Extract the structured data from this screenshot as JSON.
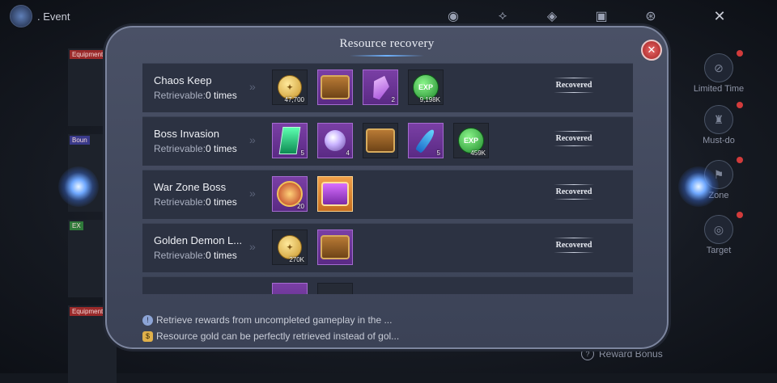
{
  "topbar": {
    "event_label": ". Event",
    "icons": [
      "portrait-icon",
      "emblem-icon",
      "crest-icon",
      "card-icon",
      "rune-icon"
    ],
    "close_glyph": "✕"
  },
  "background_tags": [
    "Equipment",
    "Boun",
    "EX",
    "Equipment"
  ],
  "sidebar_right": [
    {
      "label": "Limited Time",
      "icon": "prohibited-icon",
      "dot": true
    },
    {
      "label": "Must-do",
      "icon": "helmet-icon",
      "dot": true
    },
    {
      "label": "Zone",
      "icon": "flag-icon",
      "dot": true
    },
    {
      "label": "Target",
      "icon": "target-icon",
      "dot": true
    }
  ],
  "reward_bonus_label": "Reward Bonus",
  "modal": {
    "title": "Resource recovery",
    "close_glyph": "✕",
    "retrievable_prefix": "Retrievable:",
    "rows": [
      {
        "name": "Chaos Keep",
        "retrievable": "0 times",
        "status": "Recovered",
        "items": [
          {
            "icon": "gold-coin-icon",
            "frame": "dark",
            "qty": "47,700"
          },
          {
            "icon": "treasure-chest-icon",
            "frame": "purple",
            "qty": ""
          },
          {
            "icon": "purple-crystal-icon",
            "frame": "purple",
            "qty": "2"
          },
          {
            "icon": "exp-orb-icon",
            "frame": "dark",
            "qty": "9,198K"
          }
        ]
      },
      {
        "name": "Boss Invasion",
        "retrievable": "0 times",
        "status": "Recovered",
        "items": [
          {
            "icon": "emerald-tablet-icon",
            "frame": "purple",
            "qty": "5"
          },
          {
            "icon": "orbit-gem-icon",
            "frame": "purple",
            "qty": "4"
          },
          {
            "icon": "treasure-chest-icon",
            "frame": "dark",
            "qty": ""
          },
          {
            "icon": "blue-feather-icon",
            "frame": "purple",
            "qty": "5"
          },
          {
            "icon": "exp-orb-icon",
            "frame": "dark",
            "qty": "459K"
          }
        ]
      },
      {
        "name": "War Zone Boss",
        "retrievable": "0 times",
        "status": "Recovered",
        "items": [
          {
            "icon": "medal-badge-icon",
            "frame": "purple",
            "qty": "20"
          },
          {
            "icon": "open-gift-box-icon",
            "frame": "gold",
            "qty": ""
          }
        ]
      },
      {
        "name": "Golden Demon L...",
        "retrievable": "0 times",
        "status": "Recovered",
        "items": [
          {
            "icon": "gold-coin-icon",
            "frame": "dark",
            "qty": "270K"
          },
          {
            "icon": "treasure-chest-icon",
            "frame": "purple",
            "qty": ""
          }
        ]
      }
    ],
    "notes": [
      {
        "icon": "info-icon",
        "glyph": "!",
        "text": "Retrieve rewards from uncompleted gameplay in the ..."
      },
      {
        "icon": "gold-bag-icon",
        "glyph": "$",
        "text": "Resource gold can be perfectly retrieved instead of gol..."
      }
    ]
  },
  "colors": {
    "panel": "#3b4256",
    "row": "#2c3242",
    "item_purple": "#7a3fa5",
    "item_gold": "#f0a04a",
    "close_red": "#d23b3b",
    "glow_blue": "#6fb2ff"
  }
}
